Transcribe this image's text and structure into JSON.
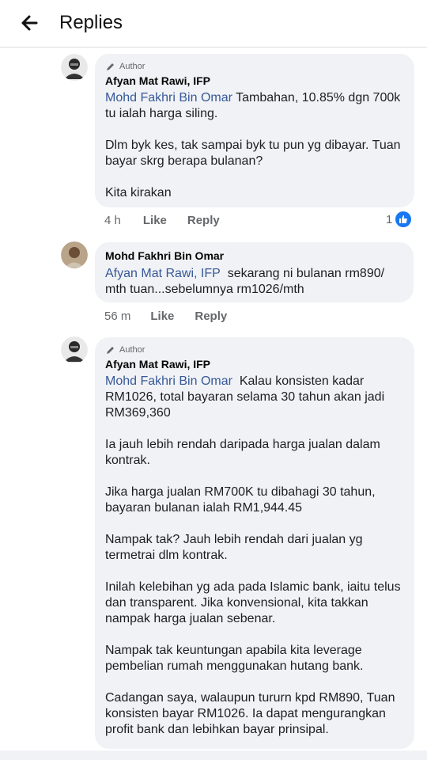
{
  "header": {
    "title": "Replies"
  },
  "comments": [
    {
      "author_tag": "Author",
      "name": "Afyan Mat Rawi, IFP",
      "mention": "Mohd Fakhri Bin Omar",
      "lines": [
        "Tambahan, 10.85% dgn 700k",
        "tu ialah harga siling.",
        "Dlm byk kes, tak sampai byk tu pun yg dibayar. Tuan",
        "bayar skrg berapa bulanan?",
        "Kita kirakan"
      ],
      "time": "4 h",
      "like": "Like",
      "reply": "Reply",
      "reaction_count": "1"
    },
    {
      "name": "Mohd Fakhri Bin Omar",
      "mention": "Afyan Mat Rawi, IFP",
      "lines": [
        "sekarang ni bulanan rm890/",
        "mth tuan...sebelumnya rm1026/mth"
      ],
      "time": "56 m",
      "like": "Like",
      "reply": "Reply"
    },
    {
      "author_tag": "Author",
      "name": "Afyan Mat Rawi, IFP",
      "mention": "Mohd Fakhri Bin Omar",
      "lines": [
        "Kalau konsisten kadar",
        "RM1026, total bayaran selama 30 tahun akan jadi",
        "RM369,360",
        "Ia jauh lebih rendah daripada harga jualan dalam",
        "kontrak.",
        "Jika harga jualan RM700K tu dibahagi 30 tahun,",
        "bayaran bulanan ialah RM1,944.45",
        "Nampak tak? Jauh lebih rendah dari jualan yg",
        "termetrai dlm kontrak.",
        "Inilah kelebihan yg ada pada Islamic bank, iaitu telus",
        "dan transparent. Jika konvensional, kita takkan",
        "nampak harga jualan sebenar.",
        "Nampak tak keuntungan apabila kita leverage",
        "pembelian rumah menggunakan hutang bank.",
        "Cadangan saya, walaupun tururn kpd RM890, Tuan",
        "konsisten bayar RM1026. Ia dapat mengurangkan",
        "profit bank dan lebihkan bayar prinsipal."
      ]
    }
  ],
  "colors": {
    "mention": "#385898",
    "bubble": "#f0f2f5",
    "meta": "#65676b",
    "like_badge": "#1877f2"
  },
  "icons": [
    "back-arrow-icon",
    "author-pencil-icon",
    "thumbs-up-icon"
  ]
}
